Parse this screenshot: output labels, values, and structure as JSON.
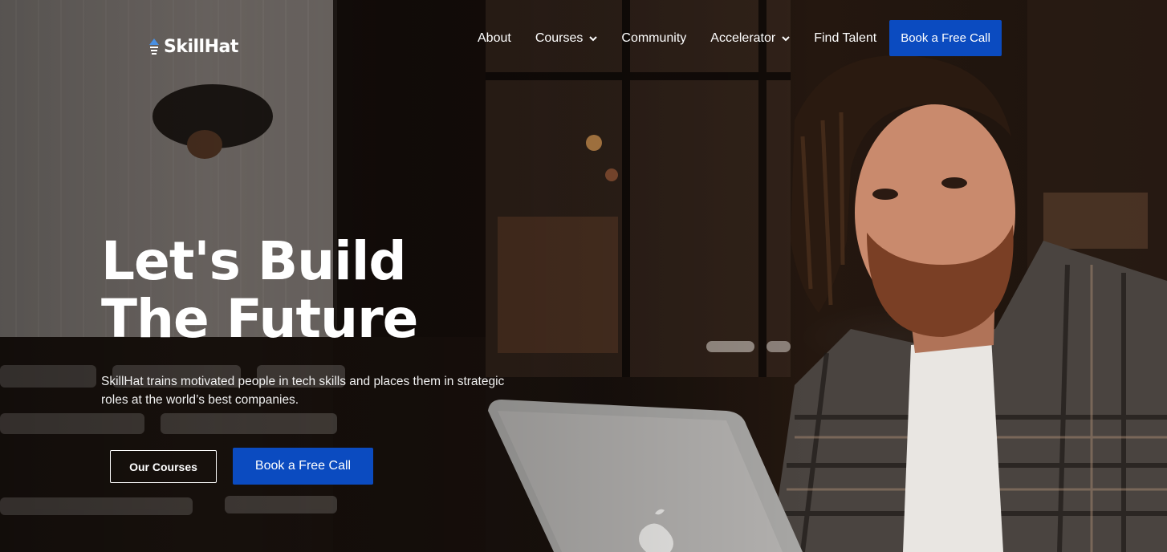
{
  "header": {
    "logo_text": "SkillHat",
    "nav": [
      {
        "label": "About",
        "dropdown": false
      },
      {
        "label": "Courses",
        "dropdown": true
      },
      {
        "label": "Community",
        "dropdown": false
      },
      {
        "label": "Accelerator",
        "dropdown": true
      },
      {
        "label": "Find Talent",
        "dropdown": false
      }
    ],
    "cta_label": "Book a Free Call"
  },
  "hero": {
    "title_line1": "Let's Build",
    "title_line2": "The Future",
    "subtitle": "SkillHat trains motivated people in tech skills and places them in strategic roles at the world’s best companies.",
    "primary_button": "Book a Free Call",
    "secondary_button": "Our Courses",
    "background_image": "man with dreadlocks in plaid shirt at laptop in cafe"
  },
  "colors": {
    "accent": "#0b4bc0",
    "logo_icon": "#4a90e2",
    "text": "#ffffff"
  },
  "icons": [
    "lightbulb-logo-icon",
    "chevron-down-icon",
    "apple-logo-icon"
  ]
}
